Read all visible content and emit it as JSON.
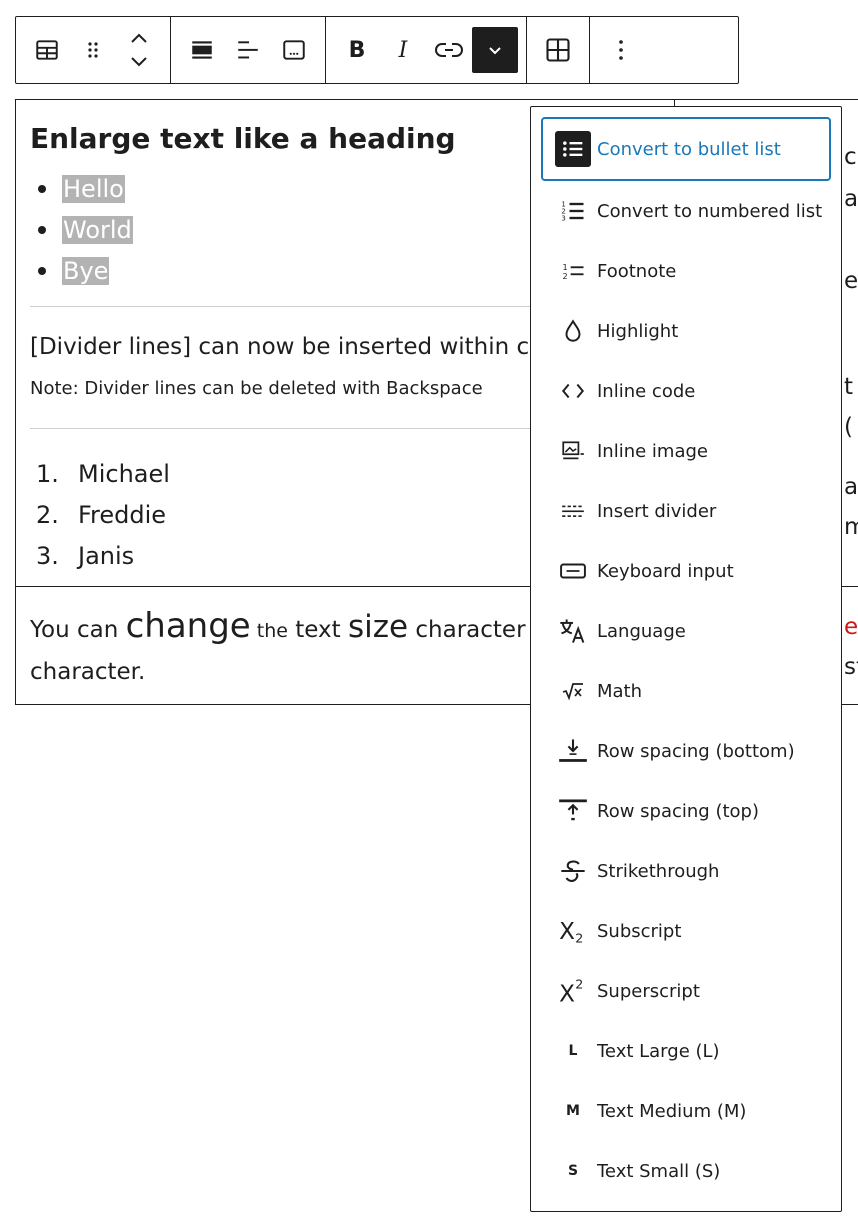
{
  "toolbar": {
    "groups": [
      [
        "table-icon",
        "drag-handle-icon",
        "move-up-down-icon"
      ],
      [
        "align-full-icon",
        "align-left-icon",
        "caption-icon"
      ],
      [
        "bold-icon",
        "italic-icon",
        "link-icon",
        "chevron-down-icon"
      ],
      [
        "table-grid-icon"
      ],
      [
        "more-options-icon"
      ]
    ],
    "bold_label": "B",
    "italic_label": "I"
  },
  "content": {
    "heading": "Enlarge text like a heading",
    "bullets": [
      "Hello",
      "World",
      "Bye"
    ],
    "divider_text": "[Divider lines] can now be inserted within c",
    "note": "Note: Divider lines can be deleted with Backspace",
    "numbered": [
      {
        "num": "1.",
        "text": "Michael"
      },
      {
        "num": "2.",
        "text": "Freddie"
      },
      {
        "num": "3.",
        "text": "Janis"
      }
    ],
    "size_line": {
      "p1": "You can ",
      "p2": "change",
      "p3": " the",
      "p4": " text ",
      "p5": "size",
      "p6": " character b"
    },
    "char_line": "character.",
    "right_clips": [
      "c",
      "a",
      "e",
      "t",
      "(",
      "a",
      "m",
      "e",
      "st"
    ]
  },
  "menu": {
    "items": [
      {
        "label": "Convert to bullet list",
        "icon": "bullet-list-icon",
        "focused": true
      },
      {
        "label": "Convert to numbered list",
        "icon": "numbered-list-icon"
      },
      {
        "label": "Footnote",
        "icon": "footnote-icon"
      },
      {
        "label": "Highlight",
        "icon": "highlight-drop-icon"
      },
      {
        "label": "Inline code",
        "icon": "code-icon"
      },
      {
        "label": "Inline image",
        "icon": "inline-image-icon"
      },
      {
        "label": "Insert divider",
        "icon": "divider-icon"
      },
      {
        "label": "Keyboard input",
        "icon": "keyboard-icon"
      },
      {
        "label": "Language",
        "icon": "language-icon"
      },
      {
        "label": "Math",
        "icon": "math-icon"
      },
      {
        "label": "Row spacing (bottom)",
        "icon": "row-spacing-bottom-icon"
      },
      {
        "label": "Row spacing (top)",
        "icon": "row-spacing-top-icon"
      },
      {
        "label": "Strikethrough",
        "icon": "strikethrough-icon"
      },
      {
        "label": "Subscript",
        "icon": "subscript-icon"
      },
      {
        "label": "Superscript",
        "icon": "superscript-icon"
      },
      {
        "label": "Text Large (L)",
        "icon": "text-large-icon",
        "glyph": "L"
      },
      {
        "label": "Text Medium (M)",
        "icon": "text-medium-icon",
        "glyph": "M"
      },
      {
        "label": "Text Small (S)",
        "icon": "text-small-icon",
        "glyph": "S"
      }
    ]
  },
  "colors": {
    "accent": "#1a78b8",
    "selection": "#b3b3b3",
    "text": "#1e1e1e",
    "red_clip": "#cc1818"
  }
}
